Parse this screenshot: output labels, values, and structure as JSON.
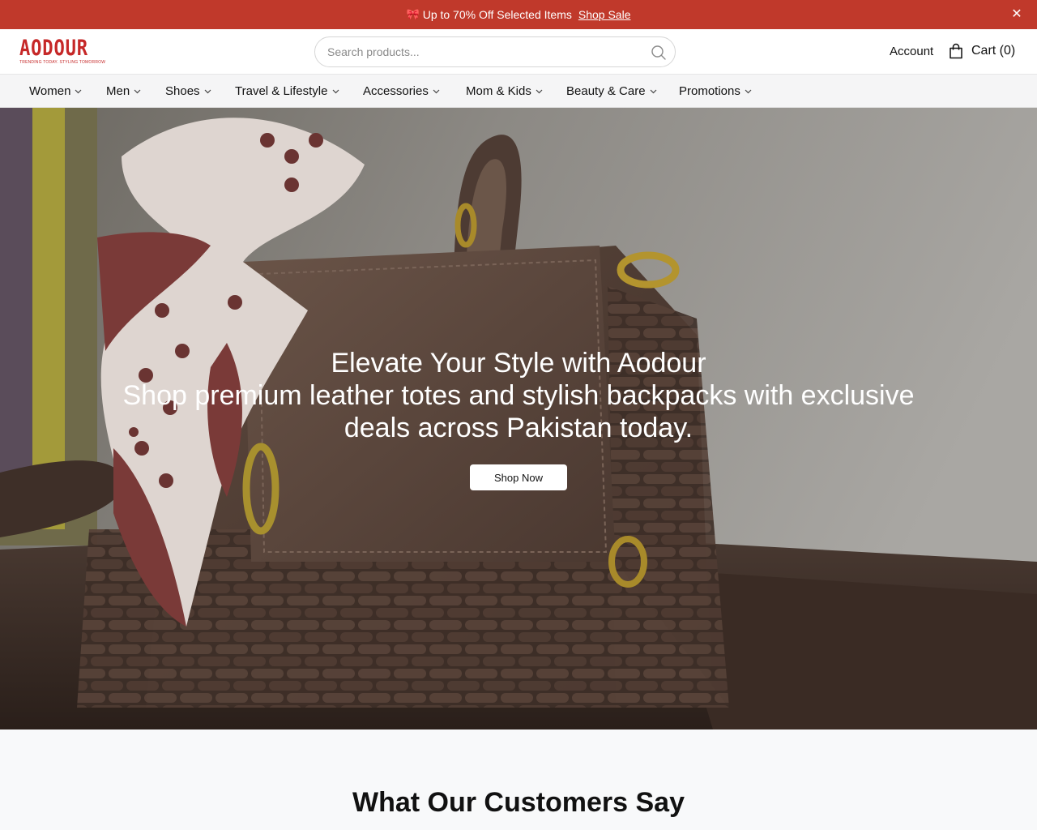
{
  "announcement": {
    "icon": "gift-icon",
    "text": "Up to 70% Off Selected Items",
    "link_label": "Shop Sale",
    "close_glyph": "✕",
    "background": "#c0392b"
  },
  "header": {
    "logo_text": "AODOUR",
    "logo_tagline": "TRENDING TODAY. STYLING TOMORROW",
    "search_placeholder": "Search products...",
    "account_label": "Account",
    "cart_label": "Cart (0)",
    "brand_color": "#c62828"
  },
  "nav": {
    "items": [
      {
        "label": "Women"
      },
      {
        "label": "Men"
      },
      {
        "label": "Shoes"
      },
      {
        "label": "Travel & Lifestyle"
      },
      {
        "label": "Accessories"
      },
      {
        "label": "Mom & Kids"
      },
      {
        "label": "Beauty & Care"
      },
      {
        "label": "Promotions"
      }
    ]
  },
  "hero": {
    "title": "Elevate Your Style with Aodour",
    "subtitle": "Shop premium leather totes and stylish backpacks with exclusive deals across Pakistan today.",
    "cta_label": "Shop Now"
  },
  "testimonials": {
    "title": "What Our Customers Say"
  }
}
